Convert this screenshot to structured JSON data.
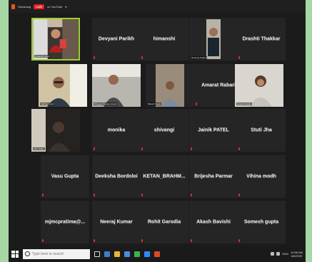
{
  "topbar": {
    "title": "Streaming",
    "live": "LIVE",
    "destination": "on YouTube",
    "caret": "▾"
  },
  "tiles": [
    {
      "id": "t1",
      "name": "",
      "caption": "Himanshi Joshi",
      "video": "speaker",
      "active": true
    },
    {
      "id": "t2",
      "name": "Devyani Parikh",
      "caption": "",
      "video": ""
    },
    {
      "id": "t3",
      "name": "himanshi",
      "caption": "",
      "video": ""
    },
    {
      "id": "t4",
      "name": "",
      "caption": "Harsung Kalpal",
      "video": "man-dark"
    },
    {
      "id": "t5",
      "name": "Drashti Thakkar",
      "caption": "",
      "video": ""
    },
    {
      "id": "t6",
      "name": "",
      "caption": "Vaibhav Joshi",
      "video": "man-glasses"
    },
    {
      "id": "t7",
      "name": "",
      "caption": "Bhargav Pandya (Host)",
      "video": "man-room"
    },
    {
      "id": "t8",
      "name": "",
      "caption": "Mitesh Nayak",
      "video": "man-plaid"
    },
    {
      "id": "t9",
      "name": "Amarat Rabari",
      "caption": "",
      "video": ""
    },
    {
      "id": "t10",
      "name": "",
      "caption": "avinash shelke",
      "video": "woman"
    },
    {
      "id": "t11",
      "name": "",
      "caption": "Lalit Yadav",
      "video": "dark-room"
    },
    {
      "id": "t12",
      "name": "monika",
      "caption": "",
      "video": ""
    },
    {
      "id": "t13",
      "name": "shivangi",
      "caption": "",
      "video": ""
    },
    {
      "id": "t14",
      "name": "Jainik PATEL",
      "caption": "",
      "video": ""
    },
    {
      "id": "t15",
      "name": "Stuti Jha",
      "caption": "",
      "video": ""
    },
    {
      "id": "t16",
      "name": "Vasu Gupta",
      "caption": "",
      "video": ""
    },
    {
      "id": "t17",
      "name": "Deeksha Bordoloi",
      "caption": "",
      "video": ""
    },
    {
      "id": "t18",
      "name": "KETAN_BRAHM...",
      "caption": "",
      "video": ""
    },
    {
      "id": "t19",
      "name": "Brijesha Parmar",
      "caption": "",
      "video": ""
    },
    {
      "id": "t20",
      "name": "Vihina modh",
      "caption": "",
      "video": ""
    },
    {
      "id": "t21",
      "name": "mjmcpratima@...",
      "caption": "",
      "video": ""
    },
    {
      "id": "t22",
      "name": "Neeraj Kumar",
      "caption": "",
      "video": ""
    },
    {
      "id": "t23",
      "name": "Rohit Garodia",
      "caption": "",
      "video": ""
    },
    {
      "id": "t24",
      "name": "Akash Bavishi",
      "caption": "",
      "video": ""
    },
    {
      "id": "t25",
      "name": "Somesh gupta",
      "caption": "",
      "video": ""
    }
  ],
  "taskbar": {
    "search_placeholder": "Type here to search",
    "language": "ENG",
    "time": "10:58 AM",
    "date": "6/5/2020"
  },
  "colors": {
    "active_border": "#9ad22e",
    "tile_bg": "#252525",
    "live_red": "#e02020",
    "mic_red": "#e03030"
  },
  "icons": {
    "start": "windows-start-icon",
    "search": "search-icon",
    "mic": "muted-mic-icon"
  }
}
